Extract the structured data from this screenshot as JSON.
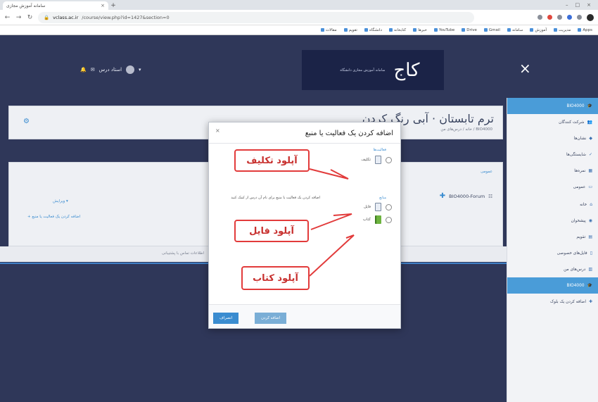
{
  "browser": {
    "tab_title": "سامانه آموزش مجازی",
    "url_domain": "vclass.ac.ir",
    "url_path": "/course/view.php?id=1427&section=0",
    "bookmarks": [
      "Apps",
      "مدیریت",
      "آموزش",
      "سامانه",
      "Gmail",
      "Drive",
      "YouTube",
      "خبرها",
      "کتابخانه",
      "دانشگاه",
      "تقویم",
      "مقالات"
    ]
  },
  "header": {
    "logo_text": "سامانه آموزش مجازی دانشگاه",
    "logo_mark": "كاج",
    "user_name": "استاد درس",
    "close_symbol": "×"
  },
  "sidebar": {
    "items": [
      {
        "label": "BIO4000",
        "icon": "graduation-cap-icon"
      },
      {
        "label": "شرکت کنندگان",
        "icon": "users-icon"
      },
      {
        "label": "نشان‌ها",
        "icon": "badge-icon"
      },
      {
        "label": "شایستگی‌ها",
        "icon": "check-icon"
      },
      {
        "label": "نمره‌ها",
        "icon": "table-icon"
      },
      {
        "label": "عمومی",
        "icon": "folder-icon"
      },
      {
        "label": "خانه",
        "icon": "home-icon"
      },
      {
        "label": "پیشخوان",
        "icon": "dashboard-icon"
      },
      {
        "label": "تقویم",
        "icon": "calendar-icon"
      },
      {
        "label": "فایل‌های خصوصی",
        "icon": "file-icon"
      },
      {
        "label": "درس‌های من",
        "icon": "book-icon"
      },
      {
        "label": "BIO4000",
        "icon": "graduation-cap-icon"
      },
      {
        "label": "اضافه کردن یک بلوک",
        "icon": "plus-icon"
      }
    ]
  },
  "course": {
    "title": "ترم تابستان · آبی رنگ کردن",
    "breadcrumb": "خانه / درس‌های من / BIO4000",
    "section_label": "عمومی",
    "activity_label": "BIO4000-Forum",
    "edit_label": "ویرایش",
    "add_label": "اضافه کردن یک فعالیت یا منبع",
    "footer_text": "اطلاعات تماس با پشتیبانی"
  },
  "modal": {
    "title": "اضافه کردن یک فعالیت یا منبع",
    "close_symbol": "×",
    "group_activities": "فعالیت‌ها",
    "group_resources": "منابع",
    "options": [
      {
        "label": "تکلیف",
        "icon": "assignment-icon"
      },
      {
        "label": "فایل",
        "icon": "file-icon"
      },
      {
        "label": "کتاب",
        "icon": "book-icon"
      }
    ],
    "description": "اضافه کردن یک فعالیت یا منبع برای نام آن درس از کمک کنید",
    "add_button": "اضافه کردن",
    "cancel_button": "انصراف"
  },
  "annotations": {
    "upload_assignment": "آپلود تکلیف",
    "upload_file": "آپلود فایل",
    "upload_book": "آپلود کتاب",
    "color": "#e23b3b"
  }
}
